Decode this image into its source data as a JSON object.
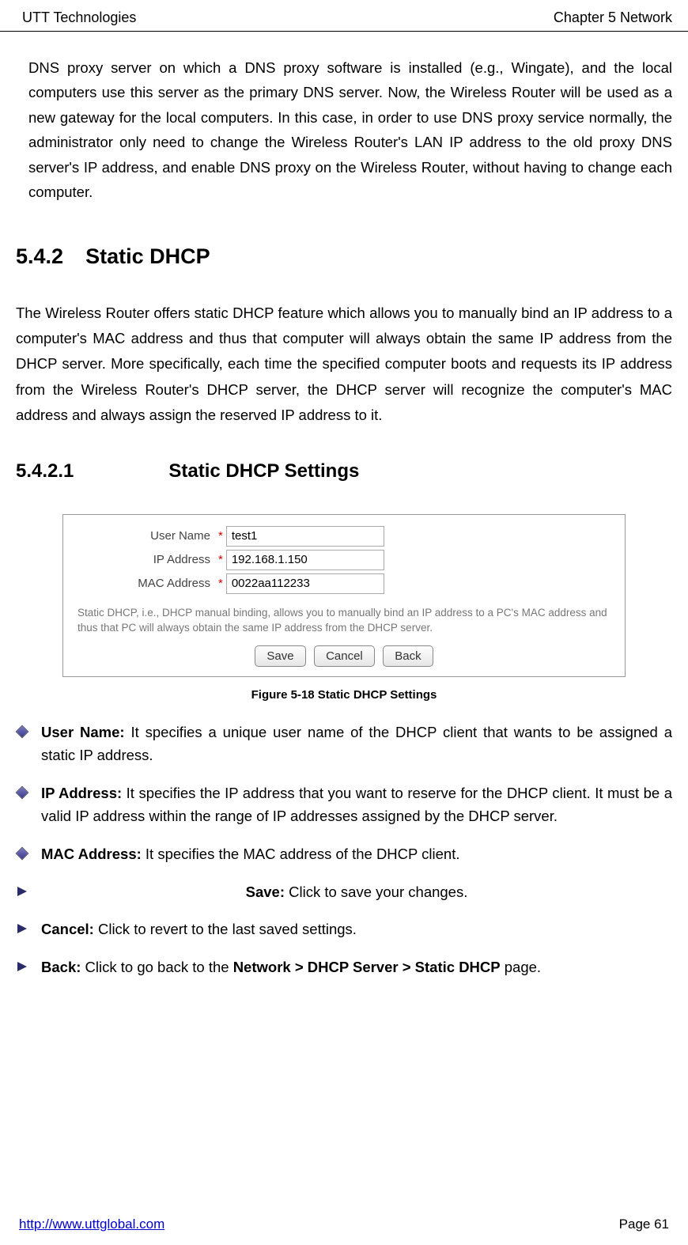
{
  "header": {
    "left": "UTT Technologies",
    "right": "Chapter 5 Network"
  },
  "intro": "DNS proxy server on which a DNS proxy software is installed (e.g., Wingate), and the local computers use this server as the primary DNS server. Now, the Wireless Router will be used as a new gateway for the local computers. In this case, in order to use DNS proxy service normally, the administrator only need to change the Wireless Router's LAN IP address to the old proxy DNS server's IP address, and enable DNS proxy on the Wireless Router, without having to change each computer.",
  "section": {
    "num": "5.4.2",
    "title": "Static DHCP"
  },
  "sectionPara": "The Wireless Router offers static DHCP feature which allows you to manually bind an IP address to a computer's MAC address and thus that computer will always obtain the same IP address from the DHCP server. More specifically, each time the specified computer boots and requests its IP address from the Wireless Router's DHCP server, the DHCP server will recognize the computer's MAC address and always assign the reserved IP address to it.",
  "subsection": {
    "num": "5.4.2.1",
    "title": "Static DHCP Settings"
  },
  "form": {
    "userNameLabel": "User Name",
    "ipLabel": "IP Address",
    "macLabel": "MAC Address",
    "userNameValue": "test1",
    "ipValue": "192.168.1.150",
    "macValue": "0022aa112233",
    "desc": "Static DHCP, i.e., DHCP manual binding, allows you to manually bind an IP address to a PC's MAC address and thus that PC will always obtain the same IP address from the DHCP server.",
    "save": "Save",
    "cancel": "Cancel",
    "back": "Back"
  },
  "figcap": "Figure 5-18 Static DHCP Settings",
  "bullets": {
    "userNameB": "User Name:",
    "userNameT": " It specifies a unique user name of the DHCP client that wants to be assigned a static IP address.",
    "ipB": "IP Address:",
    "ipT": " It specifies the IP address that you want to reserve for the DHCP client. It must be a valid IP address within the range of IP addresses assigned by the DHCP server.",
    "macB": "MAC Address:",
    "macT": " It specifies the MAC address of the DHCP client.",
    "saveB": "Save:",
    "saveT": " Click to save your changes.",
    "cancelB": "Cancel:",
    "cancelT": " Click to revert to the last saved settings.",
    "backB": "Back:",
    "backT1": " Click to go back to the ",
    "backPath": "Network > DHCP Server > Static DHCP",
    "backT2": " page."
  },
  "footer": {
    "url": "http://www.uttglobal.com",
    "page": "Page 61"
  }
}
